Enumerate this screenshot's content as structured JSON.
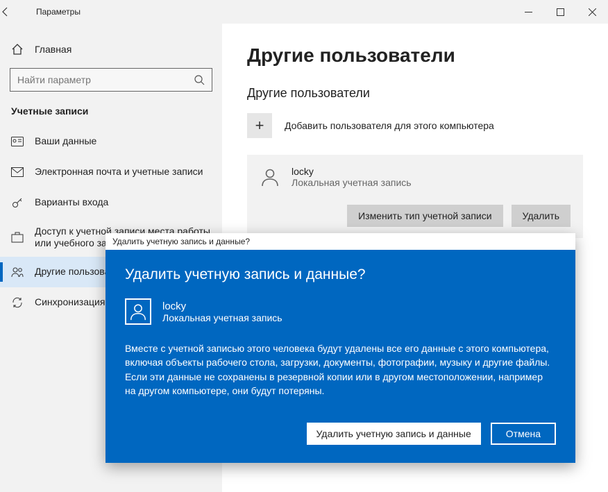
{
  "window": {
    "title": "Параметры"
  },
  "sidebar": {
    "home": "Главная",
    "search_placeholder": "Найти параметр",
    "section": "Учетные записи",
    "items": [
      {
        "label": "Ваши данные"
      },
      {
        "label": "Электронная почта и учетные записи"
      },
      {
        "label": "Варианты входа"
      },
      {
        "label": "Доступ к учетной записи места работы или учебного заведения"
      },
      {
        "label": "Другие пользователи"
      },
      {
        "label": "Синхронизация ваших параметров"
      }
    ]
  },
  "main": {
    "page_title": "Другие пользователи",
    "subheader": "Другие пользователи",
    "add_label": "Добавить пользователя для этого компьютера",
    "user": {
      "name": "locky",
      "type": "Локальная учетная запись"
    },
    "buttons": {
      "change_type": "Изменить тип учетной записи",
      "delete": "Удалить"
    }
  },
  "dialog": {
    "titlebar": "Удалить учетную запись и данные?",
    "heading": "Удалить учетную запись и данные?",
    "user": {
      "name": "locky",
      "type": "Локальная учетная запись"
    },
    "body": "Вместе с учетной записью этого человека будут удалены все его данные с этого компьютера, включая объекты рабочего стола, загрузки, документы, фотографии, музыку и другие файлы. Если эти данные не сохранены в резервной копии или в другом местоположении, например на другом компьютере, они будут потеряны.",
    "confirm": "Удалить учетную запись и данные",
    "cancel": "Отмена"
  }
}
